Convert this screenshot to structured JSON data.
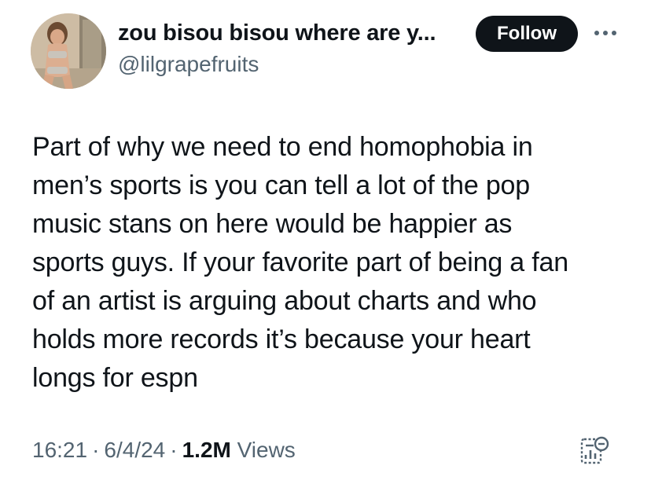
{
  "author": {
    "display_name": "zou bisou bisou where are y...",
    "handle": "@lilgrapefruits",
    "avatar_icon": "profile-photo"
  },
  "header": {
    "follow_label": "Follow",
    "more_icon": "more-horizontal-icon"
  },
  "tweet": {
    "lines": [
      "Part of why we need to end homophobia in",
      "men’s sports is you can tell a lot of the pop",
      "music stans on here would be happier as",
      "sports guys. If your favorite part of being a fan",
      "of an artist is arguing about charts and who",
      "holds more records it’s because your heart",
      "longs for espn"
    ]
  },
  "meta": {
    "time": "16:21",
    "date": "6/4/24",
    "separator": "·",
    "views_count": "1.2M",
    "views_label": "Views",
    "analytics_icon": "view-analytics-icon"
  },
  "colors": {
    "text": "#0f1419",
    "secondary": "#536471",
    "button_bg": "#0f1419",
    "button_text": "#ffffff"
  }
}
